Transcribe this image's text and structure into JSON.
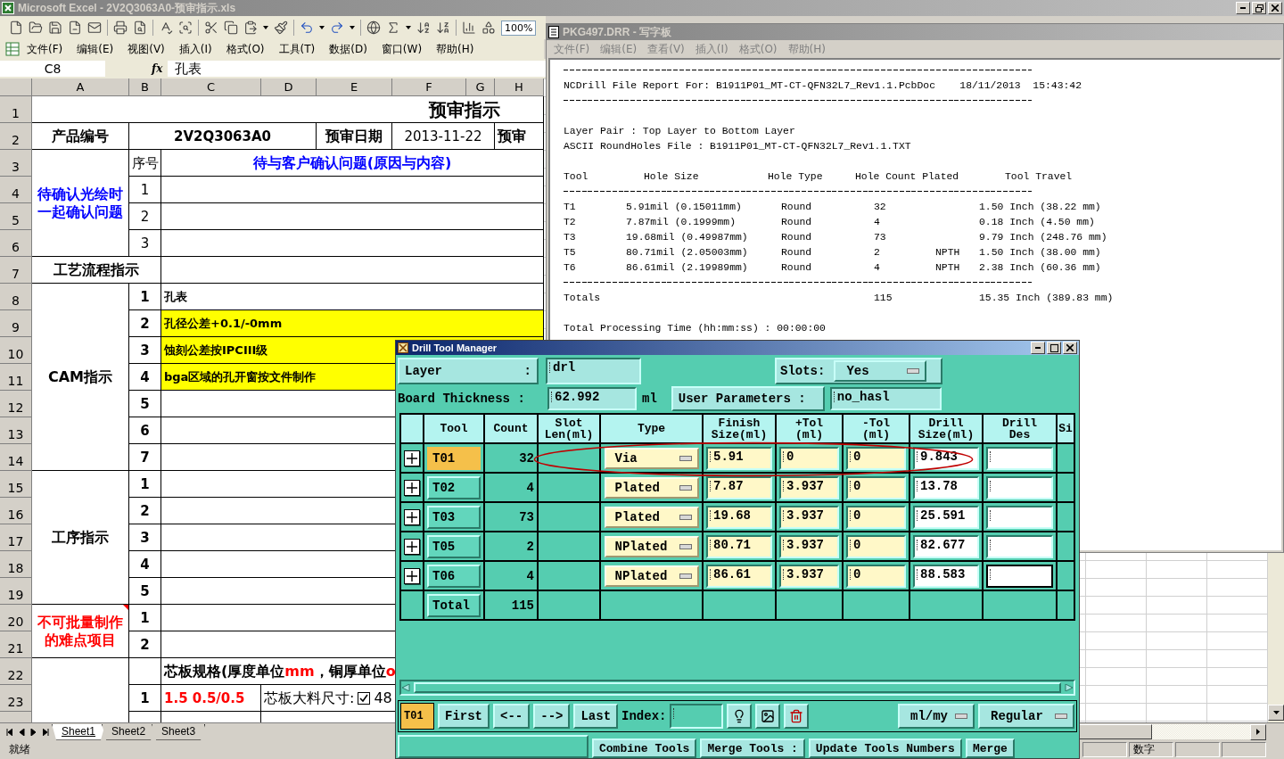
{
  "excel": {
    "title": "Microsoft Excel - 2V2Q3063A0-预审指示.xls",
    "zoom": "100%",
    "menu": [
      "文件(F)",
      "编辑(E)",
      "视图(V)",
      "插入(I)",
      "格式(O)",
      "工具(T)",
      "数据(D)",
      "窗口(W)",
      "帮助(H)"
    ],
    "name_box": "C8",
    "fx": "fx",
    "formula": "孔表",
    "columns": [
      "A",
      "B",
      "C",
      "D",
      "E",
      "F",
      "G",
      "H"
    ],
    "row_numbers": [
      "1",
      "2",
      "3",
      "4",
      "5",
      "6",
      "7",
      "8",
      "9",
      "10",
      "11",
      "12",
      "13",
      "14",
      "15",
      "16",
      "17",
      "18",
      "19",
      "20",
      "21",
      "22",
      "23"
    ],
    "cells": [
      {
        "text": "预审指示",
        "color": "#000000",
        "bold": true,
        "highlight": false,
        "comment": false
      },
      {
        "text": "产品编号",
        "color": "#000000",
        "bold": true,
        "highlight": false,
        "comment": false
      },
      {
        "text": "2V2Q3063A0",
        "color": "#000000",
        "bold": true,
        "highlight": false,
        "comment": false
      },
      {
        "text": "预审日期",
        "color": "#000000",
        "bold": true,
        "highlight": false,
        "comment": false
      },
      {
        "text": "2013-11-22",
        "color": "#000000",
        "bold": false,
        "highlight": false,
        "comment": false
      },
      {
        "text": "预审",
        "color": "#000000",
        "bold": true,
        "highlight": false,
        "comment": false
      },
      {
        "text": "待确认光绘时一起确认问题",
        "color": "#0000ff",
        "bold": true,
        "highlight": false,
        "comment": false
      },
      {
        "text": "序号",
        "color": "#000000",
        "bold": false,
        "highlight": false,
        "comment": false
      },
      {
        "text": "待与客户确认问题(原因与内容)",
        "color": "#0000ff",
        "bold": true,
        "highlight": false,
        "comment": false
      },
      {
        "text": "1",
        "color": "#000000",
        "bold": false,
        "highlight": false,
        "comment": false
      },
      {
        "text": "2",
        "color": "#000000",
        "bold": false,
        "highlight": false,
        "comment": false
      },
      {
        "text": "3",
        "color": "#000000",
        "bold": false,
        "highlight": false,
        "comment": false
      },
      {
        "text": "工艺流程指示",
        "color": "#000000",
        "bold": true,
        "highlight": false,
        "comment": false
      },
      {
        "text": "CAM指示",
        "color": "#000000",
        "bold": true,
        "highlight": false,
        "comment": false
      },
      {
        "text": "1",
        "color": "#000000",
        "bold": true,
        "highlight": false,
        "comment": false
      },
      {
        "text": "2",
        "color": "#000000",
        "bold": true,
        "highlight": false,
        "comment": false
      },
      {
        "text": "3",
        "color": "#000000",
        "bold": true,
        "highlight": false,
        "comment": false
      },
      {
        "text": "4",
        "color": "#000000",
        "bold": true,
        "highlight": false,
        "comment": false
      },
      {
        "text": "5",
        "color": "#000000",
        "bold": true,
        "highlight": false,
        "comment": false
      },
      {
        "text": "6",
        "color": "#000000",
        "bold": true,
        "highlight": false,
        "comment": false
      },
      {
        "text": "7",
        "color": "#000000",
        "bold": true,
        "highlight": false,
        "comment": false
      },
      {
        "text": "孔表",
        "color": "#000000",
        "bold": true,
        "highlight": false,
        "comment": false
      },
      {
        "text": "孔径公差+0.1/-0mm",
        "color": "#000000",
        "bold": true,
        "highlight": true,
        "comment": false
      },
      {
        "text": "蚀刻公差按IPCIII级",
        "color": "#000000",
        "bold": true,
        "highlight": true,
        "comment": false
      },
      {
        "text": "bga区域的孔开窗按文件制作",
        "color": "#000000",
        "bold": true,
        "highlight": true,
        "comment": false
      },
      {
        "text": "工序指示",
        "color": "#000000",
        "bold": true,
        "highlight": false,
        "comment": false
      },
      {
        "text": "1",
        "color": "#000000",
        "bold": true,
        "highlight": false,
        "comment": false
      },
      {
        "text": "2",
        "color": "#000000",
        "bold": true,
        "highlight": false,
        "comment": false
      },
      {
        "text": "3",
        "color": "#000000",
        "bold": true,
        "highlight": false,
        "comment": false
      },
      {
        "text": "4",
        "color": "#000000",
        "bold": true,
        "highlight": false,
        "comment": false
      },
      {
        "text": "5",
        "color": "#000000",
        "bold": true,
        "highlight": false,
        "comment": false
      },
      {
        "text": "不可批量制作的难点项目",
        "color": "#ff0000",
        "bold": true,
        "highlight": false,
        "comment": true
      },
      {
        "text": "1",
        "color": "#000000",
        "bold": true,
        "highlight": false,
        "comment": false
      },
      {
        "text": "2",
        "color": "#000000",
        "bold": true,
        "highlight": false,
        "comment": false
      },
      {
        "parts": [
          {
            "text": "芯板规格(厚度单位",
            "color": "#000000"
          },
          {
            "text": "mm",
            "color": "#ff0000"
          },
          {
            "text": "，铜厚单位",
            "color": "#000000"
          },
          {
            "text": "o",
            "color": "#ff0000"
          }
        ],
        "bold": true,
        "highlight": false,
        "comment": false
      },
      {
        "text": "1",
        "color": "#000000",
        "bold": true,
        "highlight": false,
        "comment": false
      },
      {
        "text": "1.5 0.5/0.5",
        "color": "#ff0000",
        "bold": true,
        "highlight": false,
        "comment": false
      },
      {
        "text": "芯板大料尺寸:",
        "checked": true,
        "after": "48",
        "color": "#000000",
        "bold": false,
        "highlight": false,
        "comment": false
      }
    ],
    "sheet_tabs": [
      {
        "label": "Sheet1",
        "selected": true
      },
      {
        "label": "Sheet2",
        "selected": false
      },
      {
        "label": "Sheet3",
        "selected": false
      }
    ],
    "status": "就绪",
    "status_right": "数字"
  },
  "wordpad": {
    "title": "PKG497.DRR - 写字板",
    "menu": [
      "文件(F)",
      "编辑(E)",
      "查看(V)",
      "插入(I)",
      "格式(O)",
      "帮助(H)"
    ],
    "lines": [
      {
        "kind": "rule"
      },
      {
        "kind": "text",
        "text": "NCDrill File Report For: B1911P01_MT-CT-QFN32L7_Rev1.1.PcbDoc    18/11/2013  15:43:42"
      },
      {
        "kind": "rule"
      },
      {
        "kind": "blank"
      },
      {
        "kind": "text",
        "text": "Layer Pair : Top Layer to Bottom Layer"
      },
      {
        "kind": "text",
        "text": "ASCII RoundHoles File : B1911P01_MT-CT-QFN32L7_Rev1.1.TXT"
      },
      {
        "kind": "blank"
      },
      {
        "kind": "header",
        "cells": [
          "Tool",
          "Hole Size",
          "Hole Type",
          "Hole Count Plated",
          "Tool Travel"
        ]
      },
      {
        "kind": "rule"
      },
      {
        "kind": "row",
        "tool": "T1",
        "size": "5.91mil (0.15011mm)",
        "type": "Round",
        "count": "32",
        "travel": "1.50 Inch (38.22 mm)"
      },
      {
        "kind": "row",
        "tool": "T2",
        "size": "7.87mil (0.1999mm)",
        "type": "Round",
        "count": "4",
        "travel": "0.18 Inch (4.50 mm)"
      },
      {
        "kind": "row",
        "tool": "T3",
        "size": "19.68mil (0.49987mm)",
        "type": "Round",
        "count": "73",
        "travel": "9.79 Inch (248.76 mm)"
      },
      {
        "kind": "row",
        "tool": "T5",
        "size": "80.71mil (2.05003mm)",
        "type": "Round",
        "count": "2",
        "plated": "NPTH",
        "travel": "1.50 Inch (38.00 mm)"
      },
      {
        "kind": "row",
        "tool": "T6",
        "size": "86.61mil (2.19989mm)",
        "type": "Round",
        "count": "4",
        "plated": "NPTH",
        "travel": "2.38 Inch (60.36 mm)"
      },
      {
        "kind": "rule"
      },
      {
        "kind": "totals",
        "label": "Totals",
        "count": "115",
        "travel": "15.35 Inch (389.83 mm)"
      },
      {
        "kind": "blank"
      },
      {
        "kind": "text",
        "text": "Total Processing Time (hh:mm:ss) : 00:00:00"
      }
    ]
  },
  "drill": {
    "title": "Drill Tool Manager",
    "layer_label": "Layer",
    "layer_colon": ":",
    "layer": "drl",
    "slots_label": "Slots:",
    "slots": "Yes",
    "thickness_label": "Board Thickness :",
    "thickness": "62.992",
    "thickness_unit": "ml",
    "user_params_label": "User Parameters :",
    "user_params": "no_hasl",
    "columns": [
      [
        "Tool"
      ],
      [
        "Count"
      ],
      [
        "Slot",
        "Len(ml)"
      ],
      [
        "Type"
      ],
      [
        "Finish",
        "Size(ml)"
      ],
      [
        "+Tol",
        "(ml)"
      ],
      [
        "-Tol",
        "(ml)"
      ],
      [
        "Drill",
        "Size(ml)"
      ],
      [
        "Drill",
        "Des"
      ],
      [
        "Si"
      ]
    ],
    "rows": [
      {
        "tool": "T01",
        "selected": true,
        "count": "32",
        "type": "Via",
        "finish": "5.91",
        "plus_tol": "0",
        "minus_tol": "0",
        "drill_size": "9.843",
        "focused": false
      },
      {
        "tool": "T02",
        "selected": false,
        "count": "4",
        "type": "Plated",
        "finish": "7.87",
        "plus_tol": "3.937",
        "minus_tol": "0",
        "drill_size": "13.78",
        "focused": false
      },
      {
        "tool": "T03",
        "selected": false,
        "count": "73",
        "type": "Plated",
        "finish": "19.68",
        "plus_tol": "3.937",
        "minus_tol": "0",
        "drill_size": "25.591",
        "focused": false
      },
      {
        "tool": "T05",
        "selected": false,
        "count": "2",
        "type": "NPlated",
        "finish": "80.71",
        "plus_tol": "3.937",
        "minus_tol": "0",
        "drill_size": "82.677",
        "focused": false
      },
      {
        "tool": "T06",
        "selected": false,
        "count": "4",
        "type": "NPlated",
        "finish": "86.61",
        "plus_tol": "3.937",
        "minus_tol": "0",
        "drill_size": "88.583",
        "focused": true
      }
    ],
    "total_label": "Total",
    "total": "115",
    "current_tool": "T01",
    "nav": [
      "First",
      "<--",
      "-->",
      "Last"
    ],
    "index_label": "Index:",
    "units": "ml/my",
    "mode": "Regular",
    "bottom_buttons": [
      "Combine Tools",
      "Merge Tools :",
      "Update Tools Numbers",
      "Merge"
    ]
  }
}
